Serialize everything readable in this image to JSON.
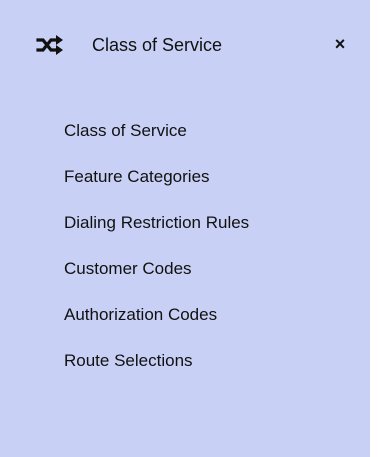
{
  "header": {
    "icon": "shuffle-icon",
    "title": "Class of Service",
    "close_label": "×"
  },
  "menu": {
    "items": [
      {
        "label": "Class of Service"
      },
      {
        "label": "Feature Categories"
      },
      {
        "label": "Dialing Restriction Rules"
      },
      {
        "label": "Customer Codes"
      },
      {
        "label": "Authorization Codes"
      },
      {
        "label": "Route Selections"
      }
    ]
  },
  "colors": {
    "panel_background": "#c8d0f5",
    "text": "#111111"
  }
}
